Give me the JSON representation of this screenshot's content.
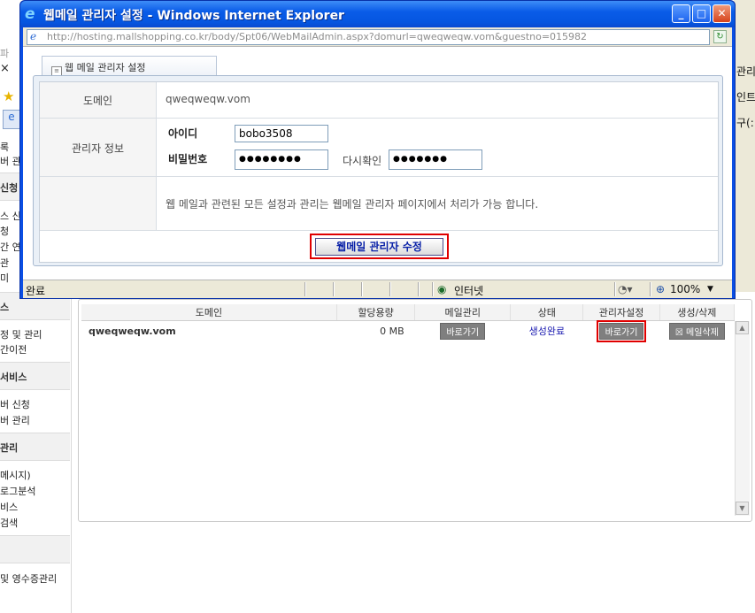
{
  "popup": {
    "title": "웹메일 관리자 설정 - Windows Internet Explorer",
    "url": "http://hosting.mallshopping.co.kr/body/Spt06/WebMailAdmin.aspx?domurl=qweqweqw.vom&guestno=015982",
    "tab_label": "웹 메일 관리자 설정",
    "domain_label": "도메인",
    "domain_value": "qweqweqw.vom",
    "admin_label": "관리자 정보",
    "id_label": "아이디",
    "id_value": "bobo3508",
    "pw_label": "비밀번호",
    "pw_value": "●●●●●●●●",
    "confirm_label": "다시확인",
    "confirm_value": "●●●●●●●",
    "notice": "웹 메일과 관련된 모든 설정과 관리는 웹메일 관리자 페이지에서 처리가 가능 합니다.",
    "submit_label": "웹메일 관리자 수정",
    "status_text": "완료",
    "zone_text": "인터넷",
    "zoom": "100%"
  },
  "main": {
    "headers": [
      "도메인",
      "할당용량",
      "메일관리",
      "상태",
      "관리자설정",
      "생성/삭제"
    ],
    "row": {
      "domain": "qweqweqw.vom",
      "quota": "0 MB",
      "mail_btn": "바로가기",
      "status": "생성완료",
      "admin_btn": "바로가기",
      "delete_btn": "메일삭제"
    }
  },
  "sidebar": {
    "fragments": {
      "top1": "파",
      "x": "×",
      "line1": "록",
      "line2": "버 관",
      "sec1": "신청",
      "line3": "스 신",
      "line4": "청",
      "line5": "간 연",
      "line6": "관",
      "line7": "미",
      "sec2": "스",
      "line8": "정 및 관리",
      "line9": "간이전",
      "sec3": "서비스",
      "line10": "버 신청",
      "line11": "버 관리",
      "sec4": "관리",
      "line12": "메시지)",
      "line13": "로그분석",
      "line14": "비스",
      "line15": "검색",
      "line16": "및 영수증관리"
    }
  },
  "right_fragments": {
    "r1": "관리",
    "r2": "인트",
    "r3": "구(:"
  },
  "colors": {
    "title_bar": "#0a5ce8",
    "highlight": "#e00000",
    "status_done": "#1a1ab0"
  }
}
